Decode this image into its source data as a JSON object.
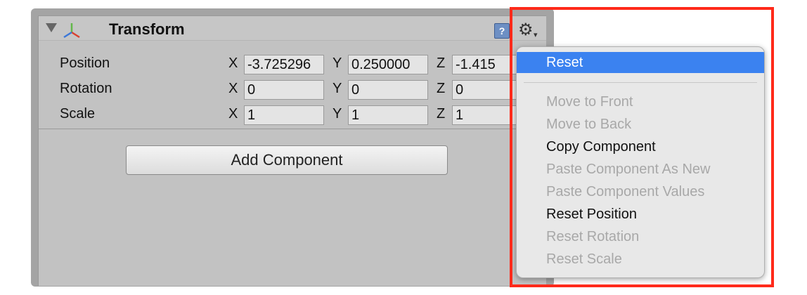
{
  "component": {
    "title": "Transform",
    "help_icon_glyph": "?",
    "gear_glyph": "⚙",
    "gear_caret": "▾"
  },
  "properties": [
    {
      "label": "Position",
      "x_axis": "X",
      "x": "-3.725296",
      "y_axis": "Y",
      "y": "0.250000",
      "z_axis": "Z",
      "z": "-1.415"
    },
    {
      "label": "Rotation",
      "x_axis": "X",
      "x": "0",
      "y_axis": "Y",
      "y": "0",
      "z_axis": "Z",
      "z": "0"
    },
    {
      "label": "Scale",
      "x_axis": "X",
      "x": "1",
      "y_axis": "Y",
      "y": "1",
      "z_axis": "Z",
      "z": "1"
    }
  ],
  "add_component_label": "Add Component",
  "context_menu": {
    "items": [
      {
        "label": "Reset",
        "enabled": true,
        "highlighted": true
      },
      {
        "label": "Move to Front",
        "enabled": false
      },
      {
        "label": "Move to Back",
        "enabled": false
      },
      {
        "label": "Copy Component",
        "enabled": true
      },
      {
        "label": "Paste Component As New",
        "enabled": false
      },
      {
        "label": "Paste Component Values",
        "enabled": false
      },
      {
        "label": "Reset Position",
        "enabled": true
      },
      {
        "label": "Reset Rotation",
        "enabled": false
      },
      {
        "label": "Reset Scale",
        "enabled": false
      }
    ]
  },
  "colors": {
    "highlight_box": "#ff2a1a",
    "menu_selection": "#3b82f0",
    "transform_icon_x": "#d9412f",
    "transform_icon_y": "#63b84a",
    "transform_icon_z": "#3c78d8"
  }
}
